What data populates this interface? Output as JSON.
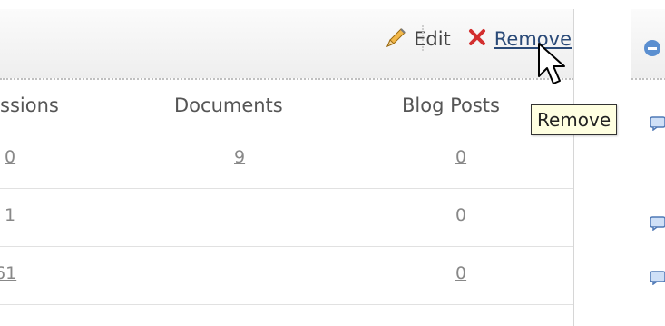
{
  "header": {
    "edit_label": "Edit",
    "remove_label": "Remove"
  },
  "table": {
    "columns": [
      "ssions",
      "Documents",
      "Blog Posts"
    ],
    "rows": [
      {
        "discussions": "0",
        "documents": "9",
        "blog_posts": "0"
      },
      {
        "discussions": "1",
        "documents": "",
        "blog_posts": "0"
      },
      {
        "discussions": "61",
        "documents": "",
        "blog_posts": "0"
      }
    ]
  },
  "tooltip": {
    "text": "Remove"
  },
  "colors": {
    "link": "#2a4a78",
    "remove_x": "#d32f2f",
    "tooltip_bg": "#ffffe1"
  },
  "icons": {
    "edit": "pencil-icon",
    "remove": "x-icon",
    "collapse": "minus-circle-icon",
    "comments": "comment-icon",
    "cursor": "mouse-pointer-icon"
  }
}
